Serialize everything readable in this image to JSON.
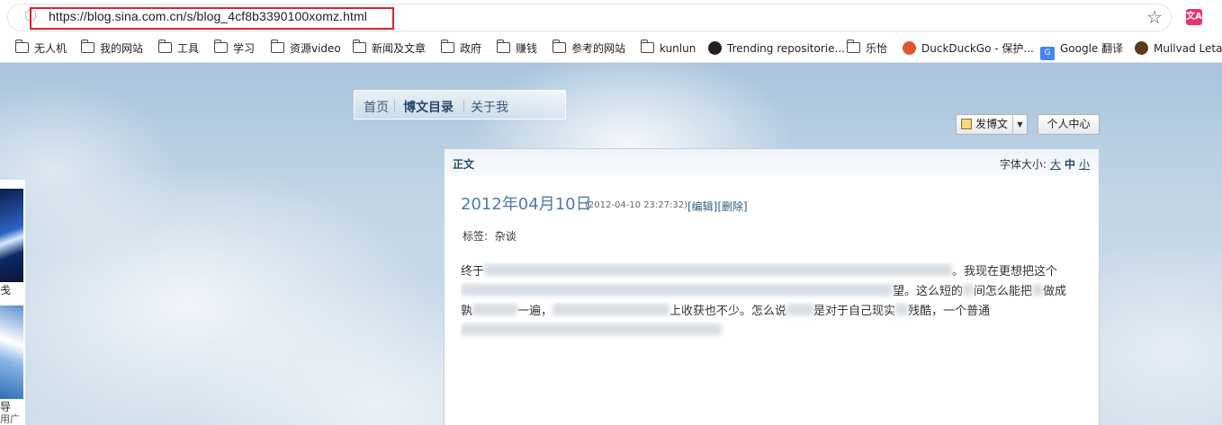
{
  "browser": {
    "url": "https://blog.sina.com.cn/s/blog_4cf8b3390100xomz.html",
    "ext_icon_label": "文A",
    "bookmarks": [
      {
        "label": "无人机",
        "icon": "folder-icon"
      },
      {
        "label": "我的网站",
        "icon": "folder-icon"
      },
      {
        "label": "工具",
        "icon": "folder-icon"
      },
      {
        "label": "学习",
        "icon": "folder-icon"
      },
      {
        "label": "资源video",
        "icon": "folder-icon"
      },
      {
        "label": "新闻及文章",
        "icon": "folder-icon"
      },
      {
        "label": "政府",
        "icon": "folder-icon"
      },
      {
        "label": "赚钱",
        "icon": "folder-icon"
      },
      {
        "label": "参考的网站",
        "icon": "folder-icon"
      },
      {
        "label": "kunlun",
        "icon": "folder-icon"
      },
      {
        "label": "Trending repositorie...",
        "icon": "github-icon"
      },
      {
        "label": "乐怡",
        "icon": "folder-icon"
      },
      {
        "label": "DuckDuckGo - 保护...",
        "icon": "duckduckgo-icon"
      },
      {
        "label": "Google 翻译",
        "icon": "google-translate-icon"
      },
      {
        "label": "Mullvad Leta",
        "icon": "mullvad-icon"
      }
    ]
  },
  "blog_nav": {
    "home": "首页",
    "catalog": "博文目录",
    "about": "关于我"
  },
  "actions": {
    "post": "发博文",
    "personal_center": "个人中心"
  },
  "left_ad": {
    "text1": "戋",
    "text2": "导",
    "text3": "用广告"
  },
  "article": {
    "section_label": "正文",
    "font_size_label": "字体大小:",
    "size_large": "大",
    "size_medium": "中",
    "size_small": "小",
    "title": "2012年04月10日",
    "timestamp": "(2012-04-10 23:27:32)",
    "edit": "[编辑]",
    "delete": "[删除]",
    "tags_label": "标签:",
    "tag": "杂谈",
    "lines": [
      {
        "parts": [
          "终于"
        ],
        "tail": "。我现在更想把这个"
      },
      {
        "parts": [
          "",
          "",
          "望。这么短的",
          "间怎么能把",
          "做成"
        ]
      },
      {
        "parts": [
          "孰",
          "一遍，",
          "",
          "上收获也不少。怎么说",
          "是对于自己现实",
          "残酷，一个普通"
        ]
      },
      {
        "parts": [
          ""
        ]
      }
    ]
  },
  "colors": {
    "accent": "#4e7bab",
    "url_highlight": "#d9252a",
    "link": "#2a5c8a"
  }
}
